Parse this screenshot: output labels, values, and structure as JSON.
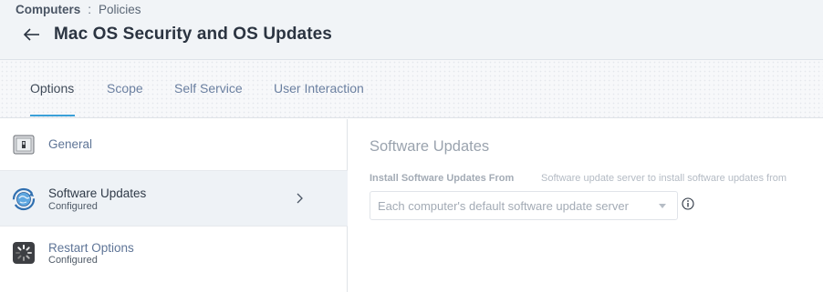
{
  "header": {
    "breadcrumb_root": "Computers",
    "breadcrumb_separator": ":",
    "breadcrumb_leaf": "Policies",
    "title": "Mac OS Security and OS Updates",
    "back_icon": "arrow-left-icon"
  },
  "tabs": [
    {
      "label": "Options",
      "active": true
    },
    {
      "label": "Scope",
      "active": false
    },
    {
      "label": "Self Service",
      "active": false
    },
    {
      "label": "User Interaction",
      "active": false
    }
  ],
  "sidebar": {
    "items": [
      {
        "label": "General",
        "sublabel": "",
        "icon": "general-switch-icon",
        "selected": false
      },
      {
        "label": "Software Updates",
        "sublabel": "Configured",
        "icon": "software-update-globe-icon",
        "selected": true
      },
      {
        "label": "Restart Options",
        "sublabel": "Configured",
        "icon": "restart-spinner-icon",
        "selected": false
      }
    ]
  },
  "content": {
    "section_title": "Software Updates",
    "field_label": "Install Software Updates From",
    "field_description": "Software update server to install software updates from",
    "select_value": "Each computer's default software update server"
  },
  "colors": {
    "accent": "#3aa0d8",
    "link": "#6a7fa0",
    "selected_row": "#eef2f6"
  }
}
